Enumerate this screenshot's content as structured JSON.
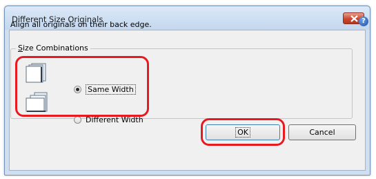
{
  "dialog": {
    "title": "Different Size Originals",
    "message": "Align all originals on their back edge.",
    "help_icon": "?",
    "group": {
      "legend_accel": "S",
      "legend_rest": "ize Combinations",
      "options": [
        {
          "label": "Same Width",
          "selected": true
        },
        {
          "label": "Different Width",
          "selected": false
        }
      ]
    },
    "buttons": {
      "ok": "OK",
      "cancel": "Cancel"
    },
    "colors": {
      "highlight": "#e8191f",
      "close_button": "#c9482f"
    }
  }
}
